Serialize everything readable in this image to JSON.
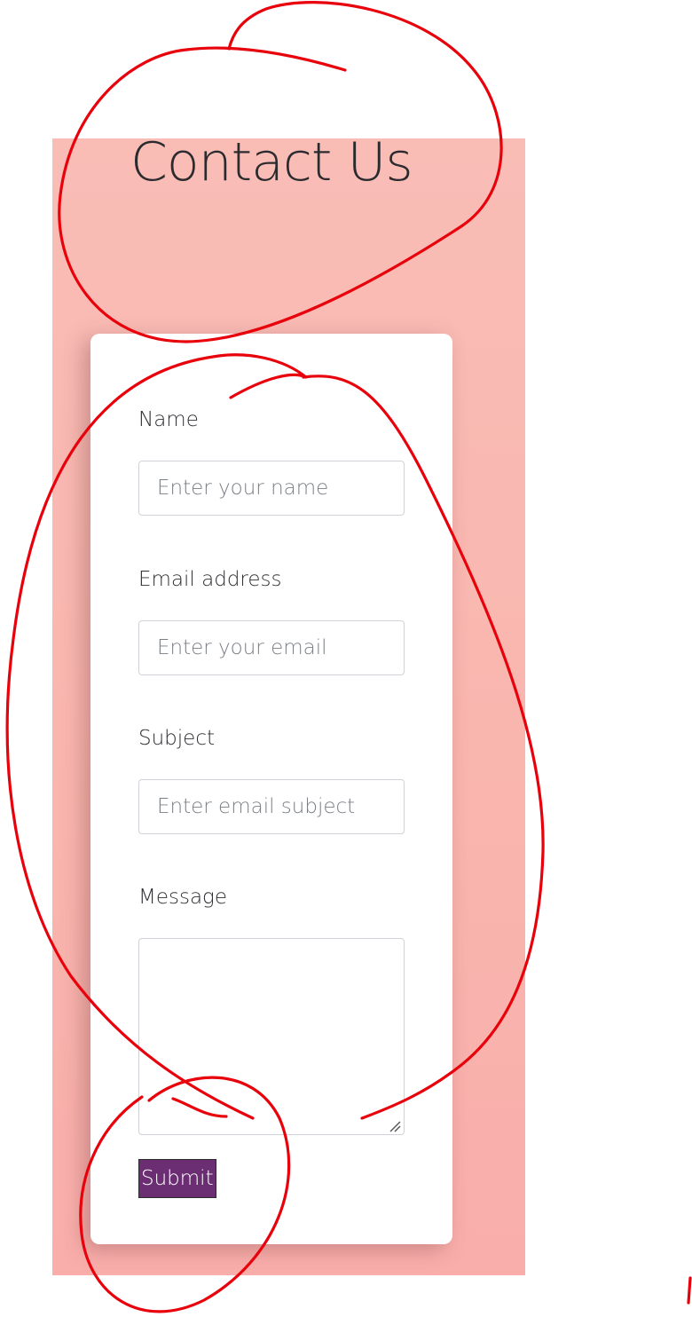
{
  "page": {
    "title": "Contact Us"
  },
  "form": {
    "name": {
      "label": "Name",
      "placeholder": "Enter your name"
    },
    "email": {
      "label": "Email address",
      "placeholder": "Enter your email"
    },
    "subject": {
      "label": "Subject",
      "placeholder": "Enter email subject"
    },
    "message": {
      "label": "Message",
      "value": ""
    },
    "submit_label": "Submit"
  },
  "colors": {
    "section_background": "#f9b5ae",
    "submit_button": "#6b2e73",
    "annotation_ink": "#e8000b"
  }
}
